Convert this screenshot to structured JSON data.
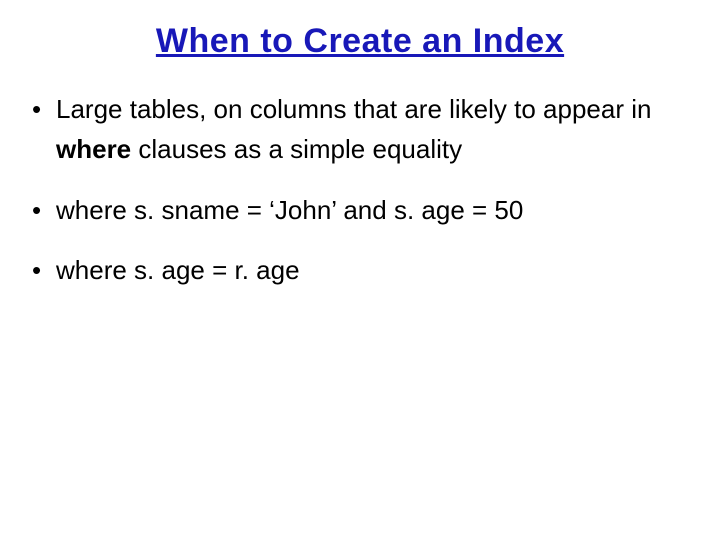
{
  "title": "When to Create an Index",
  "bullets": [
    {
      "pre": "Large tables, on columns that are likely to appear in ",
      "kw": "where",
      "post": " clauses as a simple equality"
    },
    {
      "pre": "where s. sname = ‘John’ and s. age = 50",
      "kw": "",
      "post": ""
    },
    {
      "pre": "where s. age = r. age",
      "kw": "",
      "post": ""
    }
  ]
}
